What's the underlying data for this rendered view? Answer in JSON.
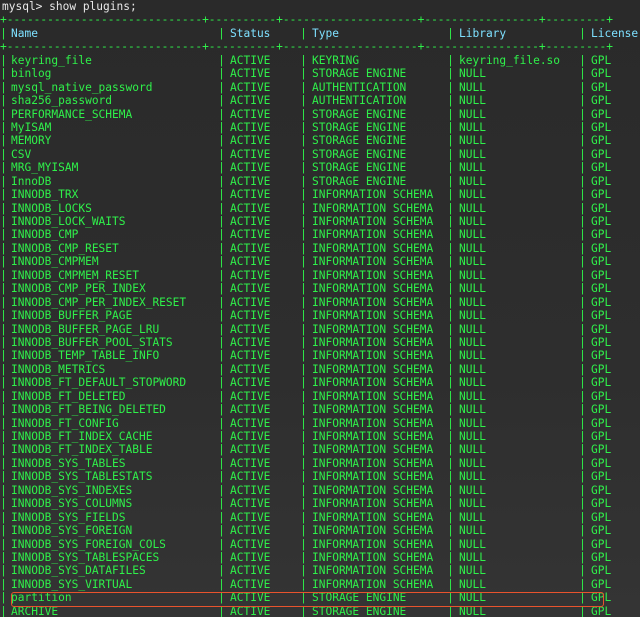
{
  "prompt": "mysql> show plugins;",
  "separator": "+-----------------------------+----------+--------------------+-----------------+---------+",
  "columns": [
    "Name",
    "Status",
    "Type",
    "Library",
    "License"
  ],
  "rows": [
    [
      "keyring_file",
      "ACTIVE",
      "KEYRING",
      "keyring_file.so",
      "GPL"
    ],
    [
      "binlog",
      "ACTIVE",
      "STORAGE ENGINE",
      "NULL",
      "GPL"
    ],
    [
      "mysql_native_password",
      "ACTIVE",
      "AUTHENTICATION",
      "NULL",
      "GPL"
    ],
    [
      "sha256_password",
      "ACTIVE",
      "AUTHENTICATION",
      "NULL",
      "GPL"
    ],
    [
      "PERFORMANCE_SCHEMA",
      "ACTIVE",
      "STORAGE ENGINE",
      "NULL",
      "GPL"
    ],
    [
      "MyISAM",
      "ACTIVE",
      "STORAGE ENGINE",
      "NULL",
      "GPL"
    ],
    [
      "MEMORY",
      "ACTIVE",
      "STORAGE ENGINE",
      "NULL",
      "GPL"
    ],
    [
      "CSV",
      "ACTIVE",
      "STORAGE ENGINE",
      "NULL",
      "GPL"
    ],
    [
      "MRG_MYISAM",
      "ACTIVE",
      "STORAGE ENGINE",
      "NULL",
      "GPL"
    ],
    [
      "InnoDB",
      "ACTIVE",
      "STORAGE ENGINE",
      "NULL",
      "GPL"
    ],
    [
      "INNODB_TRX",
      "ACTIVE",
      "INFORMATION SCHEMA",
      "NULL",
      "GPL"
    ],
    [
      "INNODB_LOCKS",
      "ACTIVE",
      "INFORMATION SCHEMA",
      "NULL",
      "GPL"
    ],
    [
      "INNODB_LOCK_WAITS",
      "ACTIVE",
      "INFORMATION SCHEMA",
      "NULL",
      "GPL"
    ],
    [
      "INNODB_CMP",
      "ACTIVE",
      "INFORMATION SCHEMA",
      "NULL",
      "GPL"
    ],
    [
      "INNODB_CMP_RESET",
      "ACTIVE",
      "INFORMATION SCHEMA",
      "NULL",
      "GPL"
    ],
    [
      "INNODB_CMPMEM",
      "ACTIVE",
      "INFORMATION SCHEMA",
      "NULL",
      "GPL"
    ],
    [
      "INNODB_CMPMEM_RESET",
      "ACTIVE",
      "INFORMATION SCHEMA",
      "NULL",
      "GPL"
    ],
    [
      "INNODB_CMP_PER_INDEX",
      "ACTIVE",
      "INFORMATION SCHEMA",
      "NULL",
      "GPL"
    ],
    [
      "INNODB_CMP_PER_INDEX_RESET",
      "ACTIVE",
      "INFORMATION SCHEMA",
      "NULL",
      "GPL"
    ],
    [
      "INNODB_BUFFER_PAGE",
      "ACTIVE",
      "INFORMATION SCHEMA",
      "NULL",
      "GPL"
    ],
    [
      "INNODB_BUFFER_PAGE_LRU",
      "ACTIVE",
      "INFORMATION SCHEMA",
      "NULL",
      "GPL"
    ],
    [
      "INNODB_BUFFER_POOL_STATS",
      "ACTIVE",
      "INFORMATION SCHEMA",
      "NULL",
      "GPL"
    ],
    [
      "INNODB_TEMP_TABLE_INFO",
      "ACTIVE",
      "INFORMATION SCHEMA",
      "NULL",
      "GPL"
    ],
    [
      "INNODB_METRICS",
      "ACTIVE",
      "INFORMATION SCHEMA",
      "NULL",
      "GPL"
    ],
    [
      "INNODB_FT_DEFAULT_STOPWORD",
      "ACTIVE",
      "INFORMATION SCHEMA",
      "NULL",
      "GPL"
    ],
    [
      "INNODB_FT_DELETED",
      "ACTIVE",
      "INFORMATION SCHEMA",
      "NULL",
      "GPL"
    ],
    [
      "INNODB_FT_BEING_DELETED",
      "ACTIVE",
      "INFORMATION SCHEMA",
      "NULL",
      "GPL"
    ],
    [
      "INNODB_FT_CONFIG",
      "ACTIVE",
      "INFORMATION SCHEMA",
      "NULL",
      "GPL"
    ],
    [
      "INNODB_FT_INDEX_CACHE",
      "ACTIVE",
      "INFORMATION SCHEMA",
      "NULL",
      "GPL"
    ],
    [
      "INNODB_FT_INDEX_TABLE",
      "ACTIVE",
      "INFORMATION SCHEMA",
      "NULL",
      "GPL"
    ],
    [
      "INNODB_SYS_TABLES",
      "ACTIVE",
      "INFORMATION SCHEMA",
      "NULL",
      "GPL"
    ],
    [
      "INNODB_SYS_TABLESTATS",
      "ACTIVE",
      "INFORMATION SCHEMA",
      "NULL",
      "GPL"
    ],
    [
      "INNODB_SYS_INDEXES",
      "ACTIVE",
      "INFORMATION SCHEMA",
      "NULL",
      "GPL"
    ],
    [
      "INNODB_SYS_COLUMNS",
      "ACTIVE",
      "INFORMATION SCHEMA",
      "NULL",
      "GPL"
    ],
    [
      "INNODB_SYS_FIELDS",
      "ACTIVE",
      "INFORMATION SCHEMA",
      "NULL",
      "GPL"
    ],
    [
      "INNODB_SYS_FOREIGN",
      "ACTIVE",
      "INFORMATION SCHEMA",
      "NULL",
      "GPL"
    ],
    [
      "INNODB_SYS_FOREIGN_COLS",
      "ACTIVE",
      "INFORMATION SCHEMA",
      "NULL",
      "GPL"
    ],
    [
      "INNODB_SYS_TABLESPACES",
      "ACTIVE",
      "INFORMATION SCHEMA",
      "NULL",
      "GPL"
    ],
    [
      "INNODB_SYS_DATAFILES",
      "ACTIVE",
      "INFORMATION SCHEMA",
      "NULL",
      "GPL"
    ],
    [
      "INNODB_SYS_VIRTUAL",
      "ACTIVE",
      "INFORMATION SCHEMA",
      "NULL",
      "GPL"
    ],
    [
      "partition",
      "ACTIVE",
      "STORAGE ENGINE",
      "NULL",
      "GPL"
    ],
    [
      "ARCHIVE",
      "ACTIVE",
      "STORAGE ENGINE",
      "NULL",
      "GPL"
    ]
  ],
  "highlighted_row": "partition",
  "colors": {
    "text": "#2ff04a",
    "header": "#7ee0ff",
    "highlight_border": "#e8532d"
  }
}
